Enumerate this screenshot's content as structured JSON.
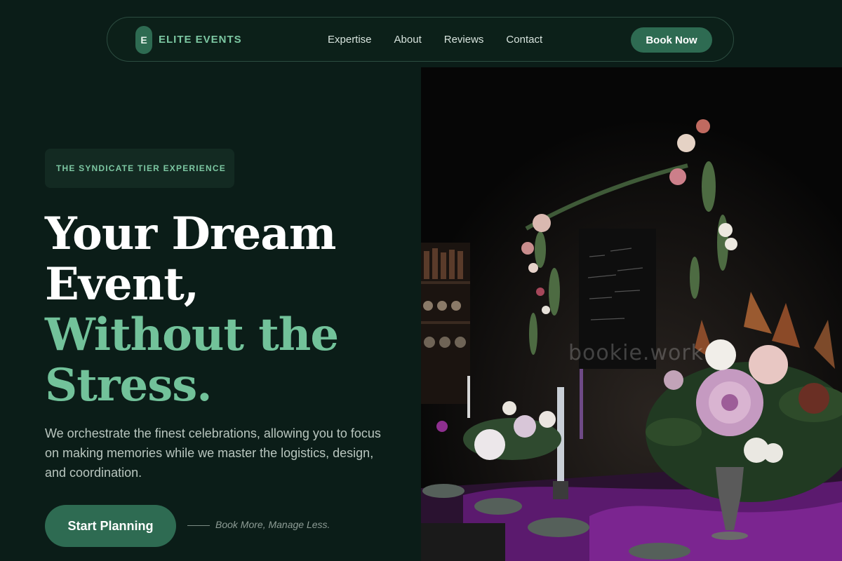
{
  "nav": {
    "logo_letter": "E",
    "brand": "ELITE EVENTS",
    "links": [
      "Expertise",
      "About",
      "Reviews",
      "Contact"
    ],
    "cta": "Book Now"
  },
  "hero": {
    "badge": "THE SYNDICATE TIER EXPERIENCE",
    "headline_white": [
      "Your Dream",
      "Event,"
    ],
    "headline_green": [
      "Without the",
      "Stress."
    ],
    "description": "We orchestrate the finest celebrations, allowing you to focus on making memories while we master the logistics, design, and coordination.",
    "cta": "Start Planning",
    "tagline": "Book More, Manage Less."
  },
  "photo": {
    "watermark": "bookie.work"
  },
  "colors": {
    "background": "#0b1d18",
    "accent": "#2e6b52",
    "accent_text": "#72c29a"
  }
}
